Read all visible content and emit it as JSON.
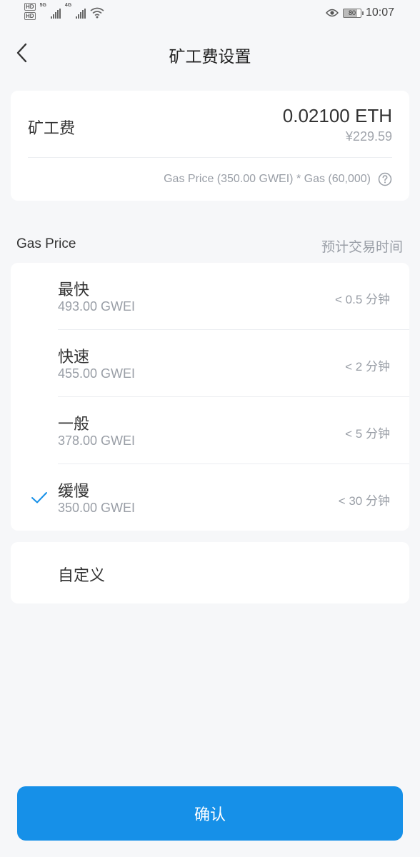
{
  "status_bar": {
    "net_a": "5G",
    "net_b": "4G",
    "battery": "80",
    "time": "10:07"
  },
  "nav": {
    "title": "矿工费设置"
  },
  "fee": {
    "label": "矿工费",
    "eth": "0.02100 ETH",
    "cny": "¥229.59",
    "formula": "Gas Price (350.00 GWEI) * Gas (60,000)"
  },
  "section": {
    "left": "Gas Price",
    "right": "预计交易时间"
  },
  "options": [
    {
      "name": "最快",
      "gwei": "493.00 GWEI",
      "time": "< 0.5 分钟"
    },
    {
      "name": "快速",
      "gwei": "455.00 GWEI",
      "time": "< 2 分钟"
    },
    {
      "name": "一般",
      "gwei": "378.00 GWEI",
      "time": "< 5 分钟"
    },
    {
      "name": "缓慢",
      "gwei": "350.00 GWEI",
      "time": "< 30 分钟",
      "selected": true
    }
  ],
  "custom": {
    "label": "自定义"
  },
  "confirm": {
    "label": "确认"
  },
  "colors": {
    "accent": "#1690e8",
    "check": "#1690e8",
    "background": "#f6f7f9"
  }
}
